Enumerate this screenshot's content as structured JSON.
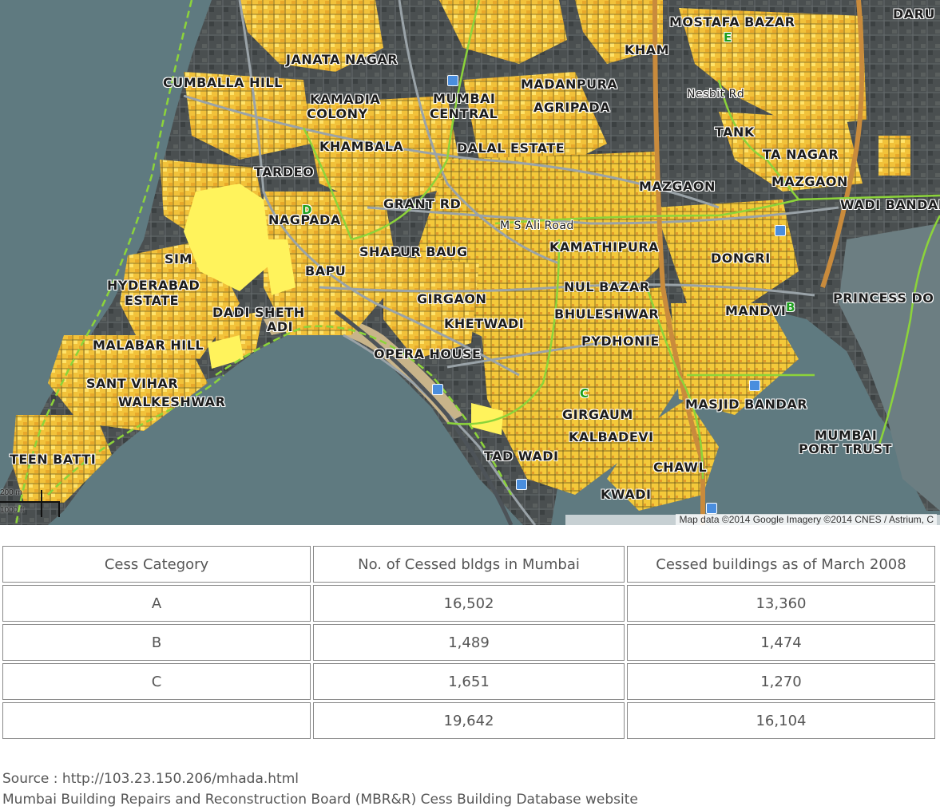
{
  "map": {
    "labels": {
      "daru": "DARU",
      "mostafa_bazar": "MOSTAFA BAZAR",
      "janata_nagar": "JANATA NAGAR",
      "cumballa_hill": "CUMBALLA HILL",
      "kamadia_colony_1": "KAMADIA",
      "kamadia_colony_2": "COLONY",
      "mumbai_central_1": "MUMBAI",
      "mumbai_central_2": "CENTRAL",
      "agripada": "AGRIPADA",
      "madanpura": "MADANPURA",
      "kham": "KHAM",
      "nesbit": "Nesbit Rd",
      "tardeo_top": "KHAMBALA",
      "dalal_estate": "DALAL ESTATE",
      "tardeo": "TARDEO",
      "tank": "TANK",
      "ta_nagar": "TA NAGAR",
      "mazgaon": "MAZGAON",
      "wadi_bandar": "WADI BANDAR",
      "grant_rd": "GRANT RD",
      "nagpada": "NAGPADA",
      "ms_ali_road": "M S Ali Road",
      "kamathipura": "KAMATHIPURA",
      "dongri": "DONGRI",
      "sim": "SIM",
      "shapur_baug": "SHAPUR BAUG",
      "bapu": "BAPU",
      "hyderabad_estate_1": "HYDERABAD",
      "hyderabad_estate_2": "ESTATE",
      "dadi_sheth": "DADI SHETH",
      "adi": "ADI",
      "girgaon": "GIRGAON",
      "nul_bazar": "NUL BAZAR",
      "princess_dock": "PRINCESS DO",
      "mandvi": "MANDVI",
      "bhuleshwar": "BHULESHWAR",
      "khetwadi": "KHETWADI",
      "malabar_hill": "MALABAR HILL",
      "opera_house": "OPERA HOUSE",
      "pydhonie": "PYDHONIE",
      "sant_vihar": "SANT VIHAR",
      "walkeshwar": "WALKESHWAR",
      "masjid_bandar": "MASJID BANDAR",
      "mumbai_port_trust_1": "MUMBAI",
      "mumbai_port_trust_2": "PORT TRUST",
      "girgaum_chowpatty": "GIRGAUM",
      "teen_batti": "TEEN BATTI",
      "tad_wadi": "TAD WADI",
      "kalbadevi": "KALBADEVI",
      "chawl": "CHAWL",
      "kwadi": "KWADI",
      "mazgaon_top": "MAZGAON"
    },
    "wards": {
      "b": "B",
      "c": "C",
      "d": "D",
      "e": "E"
    },
    "scale_top": "200 m",
    "scale_bottom": "1000 ft",
    "attribution": "Map data ©2014 Google Imagery ©2014 CNES / Astrium, C",
    "colors": {
      "water": "#5f7a80",
      "land": "#3d4447",
      "cessed": "#f7c531",
      "cessed_light": "#fff35c",
      "ward_border": "#8cd43a",
      "road": "#9aa3a8",
      "rail": "#c98b3c"
    }
  },
  "table": {
    "headers": [
      "Cess Category",
      "No. of Cessed bldgs in Mumbai",
      "Cessed buildings as of March 2008"
    ],
    "rows": [
      [
        "A",
        "16,502",
        "13,360"
      ],
      [
        "B",
        "1,489",
        "1,474"
      ],
      [
        "C",
        "1,651",
        "1,270"
      ],
      [
        "",
        "19,642",
        "16,104"
      ]
    ]
  },
  "source": {
    "line1": "Source : http://103.23.150.206/mhada.html",
    "line2": "Mumbai Building Repairs and Reconstruction Board (MBR&R) Cess Building Database website"
  }
}
